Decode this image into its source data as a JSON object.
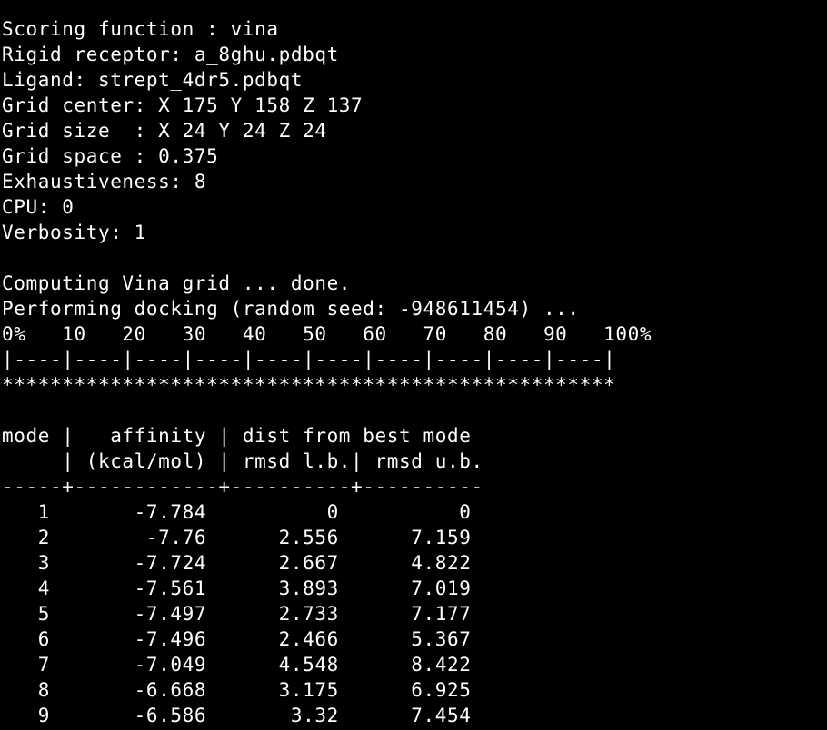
{
  "config": {
    "scoring": "Scoring function : vina",
    "receptor": "Rigid receptor: a_8ghu.pdbqt",
    "ligand": "Ligand: strept_4dr5.pdbqt",
    "grid_center": "Grid center: X 175 Y 158 Z 137",
    "grid_size": "Grid size  : X 24 Y 24 Z 24",
    "grid_space": "Grid space : 0.375",
    "exhaustiveness": "Exhaustiveness: 8",
    "cpu": "CPU: 0",
    "verbosity": "Verbosity: 1"
  },
  "progress": {
    "computing": "Computing Vina grid ... done.",
    "docking": "Performing docking (random seed: -948611454) ...",
    "scale": "0%   10   20   30   40   50   60   70   80   90   100%",
    "ruler": "|----|----|----|----|----|----|----|----|----|----|",
    "stars": "***************************************************"
  },
  "results": {
    "header1": "mode |   affinity | dist from best mode",
    "header2": "     | (kcal/mol) | rmsd l.b.| rmsd u.b.",
    "separator": "-----+------------+----------+----------",
    "rows": [
      "   1       -7.784          0          0",
      "   2        -7.76      2.556      7.159",
      "   3       -7.724      2.667      4.822",
      "   4       -7.561      3.893      7.019",
      "   5       -7.497      2.733      7.177",
      "   6       -7.496      2.466      5.367",
      "   7       -7.049      4.548      8.422",
      "   8       -6.668      3.175      6.925",
      "   9       -6.586       3.32      7.454"
    ]
  }
}
